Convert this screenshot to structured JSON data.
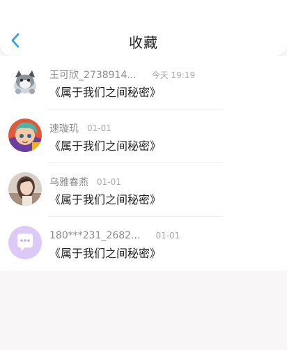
{
  "header": {
    "title": "收藏",
    "back_icon": "chevron-left-icon",
    "accent_color": "#2d9bf0"
  },
  "favorites": [
    {
      "name": "王可欣_2738914...",
      "time": "今天 19:19",
      "message": "《属于我们之间秘密》"
    },
    {
      "name": "速璇玑",
      "time": "01-01",
      "message": "《属于我们之间秘密》"
    },
    {
      "name": "乌雅春燕",
      "time": "01-01",
      "message": "《属于我们之间秘密》"
    },
    {
      "name": "180***231_2682...",
      "time": "01-01",
      "message": "《属于我们之间秘密》"
    }
  ]
}
